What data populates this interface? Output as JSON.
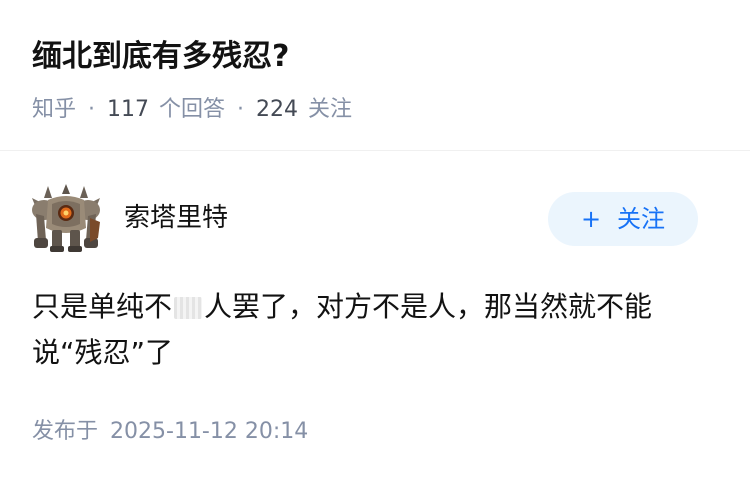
{
  "question": {
    "title": "缅北到底有多残忍?",
    "source": "知乎",
    "separator": "·",
    "answer_count": "117",
    "answer_label": "个回答",
    "follower_count": "224",
    "follower_label": "关注"
  },
  "answer": {
    "author_name": "索塔里特",
    "avatar_icon": "armored-golem-avatar-icon",
    "follow_button": {
      "plus": "+",
      "label": "关注"
    },
    "content_part1": "只是单纯不",
    "content_part2": "人罢了，对方不是人，那当然就不能说“残忍”了",
    "published_label": "发布于",
    "published_time": "2025-11-12 20:14"
  },
  "colors": {
    "meta_gray": "#8590a6",
    "follow_bg": "#ebf5fd",
    "follow_text": "#1772f6"
  }
}
